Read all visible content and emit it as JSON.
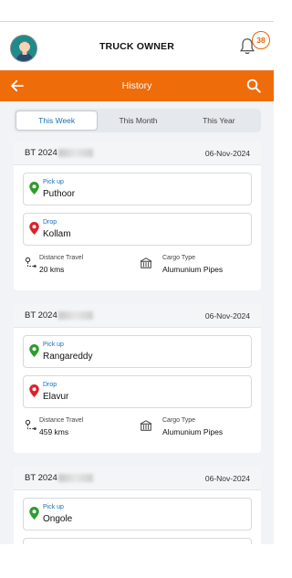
{
  "app": {
    "title": "TRUCK OWNER",
    "notification_count": "38"
  },
  "header": {
    "title": "History"
  },
  "tabs": [
    {
      "label": "This Week",
      "active": true
    },
    {
      "label": "This Month",
      "active": false
    },
    {
      "label": "This Year",
      "active": false
    }
  ],
  "labels": {
    "pickup": "Pick up",
    "drop": "Drop",
    "distance": "Distance Travel",
    "cargo": "Cargo Type"
  },
  "trips": [
    {
      "id_prefix": "BT 2024",
      "date": "06-Nov-2024",
      "pickup": "Puthoor",
      "drop": "Kollam",
      "distance": "20 kms",
      "cargo": "Alumunium Pipes"
    },
    {
      "id_prefix": "BT 2024",
      "date": "06-Nov-2024",
      "pickup": "Rangareddy",
      "drop": "Elavur",
      "distance": "459 kms",
      "cargo": "Alumunium Pipes"
    },
    {
      "id_prefix": "BT 2024",
      "date": "06-Nov-2024",
      "pickup": "Ongole"
    }
  ],
  "colors": {
    "accent": "#ef6c0b",
    "link": "#1a6fb5",
    "pickup_pin": "#2e9b2e",
    "drop_pin": "#d8232a"
  }
}
